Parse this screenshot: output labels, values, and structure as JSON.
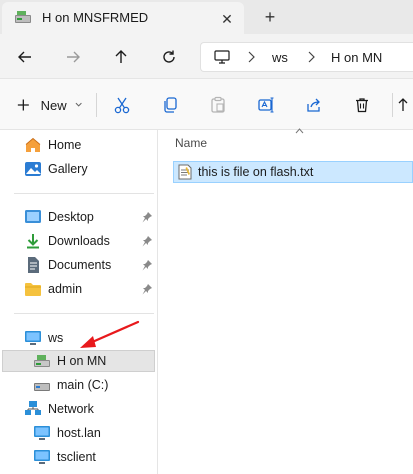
{
  "window": {
    "tab_title": "H on MNSFRMED",
    "close_symbol": "✕",
    "new_tab_symbol": "+"
  },
  "address": {
    "breadcrumbs": [
      "ws",
      "H on MN"
    ]
  },
  "toolbar": {
    "new_label": "New",
    "icons": [
      "cut-icon",
      "copy-icon",
      "paste-icon",
      "rename-icon",
      "share-icon",
      "delete-icon",
      "sort-icon"
    ]
  },
  "sidebar": {
    "items": [
      {
        "label": "Home",
        "icon": "home-icon"
      },
      {
        "label": "Gallery",
        "icon": "gallery-icon"
      },
      {
        "label": "Desktop",
        "icon": "desktop-folder-icon",
        "pinned": true
      },
      {
        "label": "Downloads",
        "icon": "downloads-icon",
        "pinned": true
      },
      {
        "label": "Documents",
        "icon": "documents-icon",
        "pinned": true
      },
      {
        "label": "admin",
        "icon": "folder-icon",
        "pinned": true
      },
      {
        "label": "ws",
        "icon": "computer-icon"
      },
      {
        "label": "H on MN",
        "icon": "network-drive-icon",
        "selected": true
      },
      {
        "label": "main (C:)",
        "icon": "drive-icon"
      },
      {
        "label": "Network",
        "icon": "network-icon"
      },
      {
        "label": "host.lan",
        "icon": "computer-icon"
      },
      {
        "label": "tsclient",
        "icon": "computer-icon"
      }
    ]
  },
  "content": {
    "column_header": "Name",
    "files": [
      {
        "name": "this is file on flash.txt",
        "icon": "text-file-icon",
        "selected": true
      }
    ]
  },
  "colors": {
    "selection_bg": "#cce8ff",
    "selection_border": "#99d1ff",
    "annotation_arrow": "#e8191c",
    "folder_yellow": "#f5c23e"
  }
}
